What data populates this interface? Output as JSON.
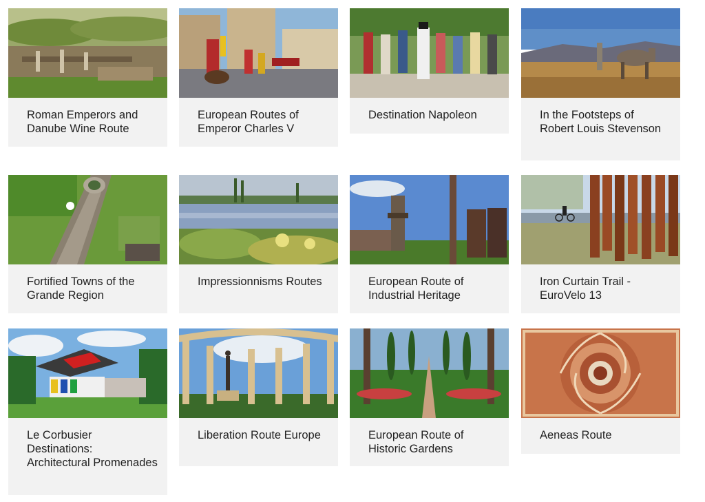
{
  "routes": [
    {
      "title": "Roman Emperors and Danube Wine Route",
      "image": "roman-ruins-vineyards-image"
    },
    {
      "title": "European Routes of Emperor Charles V",
      "image": "charles-v-procession-image"
    },
    {
      "title": "Destination Napoleon",
      "image": "napoleon-reenactment-crowd-image"
    },
    {
      "title": "In the Footsteps of Robert Louis Stevenson",
      "image": "donkey-mountain-landscape-image"
    },
    {
      "title": "Fortified Towns of the Grande Region",
      "image": "fortress-aerial-image"
    },
    {
      "title": "Impressionnisms Routes",
      "image": "impressionist-painting-image"
    },
    {
      "title": "European Route of Industrial Heritage",
      "image": "blast-furnace-industrial-image"
    },
    {
      "title": "Iron Curtain Trail - EuroVelo 13",
      "image": "cyclist-rusty-pillars-image"
    },
    {
      "title": "Le Corbusier Destinations: Architectural Promenades",
      "image": "le-corbusier-pavilion-image"
    },
    {
      "title": "Liberation Route Europe",
      "image": "memorial-colonnade-statue-image"
    },
    {
      "title": "European Route of Historic Gardens",
      "image": "cypress-garden-image"
    },
    {
      "title": "Aeneas Route",
      "image": "roman-mosaic-image"
    }
  ]
}
